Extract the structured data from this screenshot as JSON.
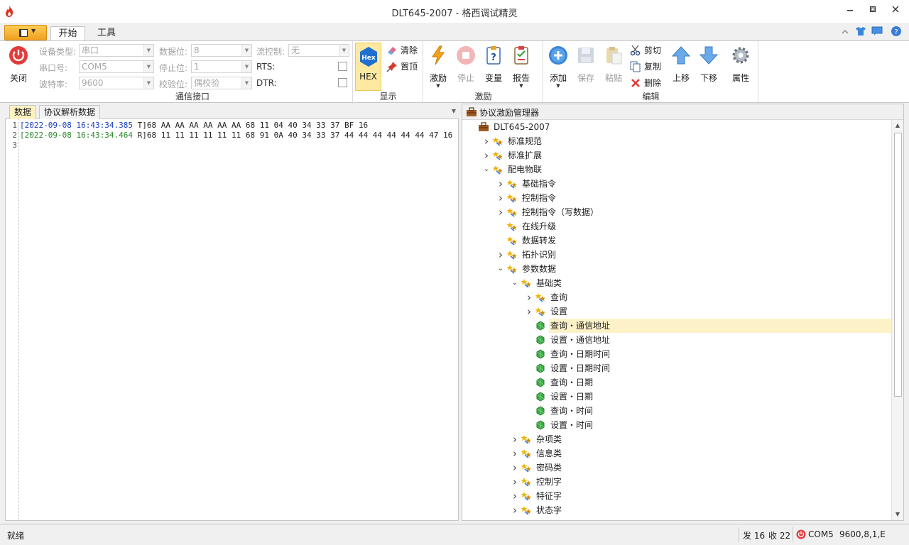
{
  "window": {
    "title": "DLT645-2007 - 格西调试精灵",
    "controls": [
      "minimize-icon",
      "restore-icon",
      "close-icon"
    ]
  },
  "ribbon": {
    "tabs": [
      {
        "label": "开始",
        "active": true
      },
      {
        "label": "工具",
        "active": false
      }
    ],
    "right_icons": [
      "collapse-ribbon-icon",
      "skin-icon",
      "feedback-icon",
      "help-icon"
    ],
    "close_button": "关闭",
    "comm": {
      "group_label": "通信接口",
      "device_type": {
        "label": "设备类型:",
        "value": "串口"
      },
      "port": {
        "label": "串口号:",
        "value": "COM5"
      },
      "baud": {
        "label": "波特率:",
        "value": "9600"
      },
      "data_bits": {
        "label": "数据位:",
        "value": "8"
      },
      "stop_bits": {
        "label": "停止位:",
        "value": "1"
      },
      "parity": {
        "label": "校验位:",
        "value": "偶校验"
      },
      "flow_control": {
        "label": "流控制:",
        "value": "无"
      },
      "rts": {
        "label": "RTS:",
        "checked": false
      },
      "dtr": {
        "label": "DTR:",
        "checked": false
      }
    },
    "display": {
      "group_label": "显示",
      "hex_label": "HEX",
      "hex_icon_text": "Hex",
      "clear": "清除",
      "pin_top": "置顶"
    },
    "stimulus": {
      "group_label": "激励",
      "stimulate": "激励",
      "stop": "停止",
      "variable": "变量",
      "report": "报告"
    },
    "edit": {
      "group_label": "编辑",
      "add": "添加",
      "save": "保存",
      "paste": "粘贴",
      "cut": "剪切",
      "copy": "复制",
      "delete": "删除",
      "move_up": "上移",
      "move_down": "下移",
      "properties": "属性"
    }
  },
  "left_panel": {
    "tabs": [
      {
        "label": "数据",
        "active": true
      },
      {
        "label": "协议解析数据",
        "active": false
      }
    ],
    "lines": [
      {
        "num": "1",
        "timestamp": "[2022-09-08 16:43:34.385",
        "dir": " T]",
        "data": "68 AA AA AA AA AA AA 68 11 04 40 34 33 37 BF 16",
        "kind": "tx"
      },
      {
        "num": "2",
        "timestamp": "[2022-09-08 16:43:34.464",
        "dir": " R]",
        "data": "68 11 11 11 11 11 11 68 91 0A 40 34 33 37 44 44 44 44 44 44 47 16",
        "kind": "rx"
      },
      {
        "num": "3",
        "timestamp": "",
        "dir": "",
        "data": "",
        "kind": "empty"
      }
    ]
  },
  "right_panel": {
    "title": "协议激励管理器",
    "tree": [
      {
        "label": "DLT645-2007",
        "level": 0,
        "expander": "none",
        "icon": "toolbox-icon"
      },
      {
        "label": "标准规范",
        "level": 1,
        "expander": "collapsed",
        "icon": "folder-stars-icon"
      },
      {
        "label": "标准扩展",
        "level": 1,
        "expander": "collapsed",
        "icon": "folder-stars-icon"
      },
      {
        "label": "配电物联",
        "level": 1,
        "expander": "expanded",
        "icon": "folder-stars-icon"
      },
      {
        "label": "基础指令",
        "level": 2,
        "expander": "collapsed",
        "icon": "folder-stars-icon"
      },
      {
        "label": "控制指令",
        "level": 2,
        "expander": "collapsed",
        "icon": "folder-stars-icon"
      },
      {
        "label": "控制指令（写数据）",
        "level": 2,
        "expander": "collapsed",
        "icon": "folder-stars-icon"
      },
      {
        "label": "在线升级",
        "level": 2,
        "expander": "none",
        "icon": "folder-stars-icon"
      },
      {
        "label": "数据转发",
        "level": 2,
        "expander": "none",
        "icon": "folder-stars-icon"
      },
      {
        "label": "拓扑识别",
        "level": 2,
        "expander": "collapsed",
        "icon": "folder-stars-icon"
      },
      {
        "label": "参数数据",
        "level": 2,
        "expander": "expanded",
        "icon": "folder-stars-icon"
      },
      {
        "label": "基础类",
        "level": 3,
        "expander": "expanded",
        "icon": "folder-stars-icon"
      },
      {
        "label": "查询",
        "level": 4,
        "expander": "collapsed",
        "icon": "folder-stars-icon"
      },
      {
        "label": "设置",
        "level": 4,
        "expander": "collapsed",
        "icon": "folder-stars-icon"
      },
      {
        "label": "查询・通信地址",
        "level": 4,
        "expander": "none",
        "icon": "green-gem-icon",
        "selected": true
      },
      {
        "label": "设置・通信地址",
        "level": 4,
        "expander": "none",
        "icon": "green-gem-icon"
      },
      {
        "label": "查询・日期时间",
        "level": 4,
        "expander": "none",
        "icon": "green-gem-icon"
      },
      {
        "label": "设置・日期时间",
        "level": 4,
        "expander": "none",
        "icon": "green-gem-icon"
      },
      {
        "label": "查询・日期",
        "level": 4,
        "expander": "none",
        "icon": "green-gem-icon"
      },
      {
        "label": "设置・日期",
        "level": 4,
        "expander": "none",
        "icon": "green-gem-icon"
      },
      {
        "label": "查询・时间",
        "level": 4,
        "expander": "none",
        "icon": "green-gem-icon"
      },
      {
        "label": "设置・时间",
        "level": 4,
        "expander": "none",
        "icon": "green-gem-icon"
      },
      {
        "label": "杂项类",
        "level": 3,
        "expander": "collapsed",
        "icon": "folder-stars-icon"
      },
      {
        "label": "信息类",
        "level": 3,
        "expander": "collapsed",
        "icon": "folder-stars-icon"
      },
      {
        "label": "密码类",
        "level": 3,
        "expander": "collapsed",
        "icon": "folder-stars-icon"
      },
      {
        "label": "控制字",
        "level": 3,
        "expander": "collapsed",
        "icon": "folder-stars-icon"
      },
      {
        "label": "特征字",
        "level": 3,
        "expander": "collapsed",
        "icon": "folder-stars-icon"
      },
      {
        "label": "状态字",
        "level": 3,
        "expander": "collapsed",
        "icon": "folder-stars-icon"
      }
    ]
  },
  "status_bar": {
    "status": "就绪",
    "sent": "发 16",
    "received": "收 22",
    "port": "COM5",
    "settings": "9600,8,1,E"
  },
  "colors": {
    "tx_timestamp": "#1a3fc0",
    "rx_timestamp": "#2a8a2a",
    "active_tab": "#fff1c2",
    "selected_row": "#fdf1c7",
    "close_red": "#e23b3b",
    "file_menu_orange": "#f0a020"
  }
}
